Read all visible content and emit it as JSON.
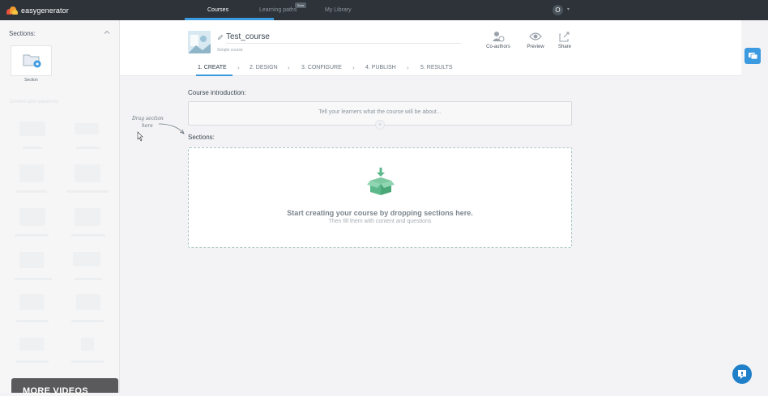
{
  "app": {
    "logo_text": "easygenerator",
    "nav": [
      {
        "label": "Courses",
        "active": true
      },
      {
        "label": "Learning paths",
        "badge": "Beta"
      },
      {
        "label": "My Library"
      }
    ],
    "user_initial": "O"
  },
  "sidebar": {
    "title": "Sections:",
    "section_card_label": "Section",
    "faded_title": "Content and questions"
  },
  "course": {
    "title": "Test_course",
    "subtitle": "Simple course",
    "actions": [
      {
        "label": "Co-authors",
        "icon": "co-authors-icon"
      },
      {
        "label": "Preview",
        "icon": "eye-icon"
      },
      {
        "label": "Share",
        "icon": "share-icon"
      }
    ],
    "steps": [
      {
        "label": "1. CREATE",
        "active": true
      },
      {
        "label": "2. DESIGN"
      },
      {
        "label": "3. CONFIGURE"
      },
      {
        "label": "4. PUBLISH"
      },
      {
        "label": "5. RESULTS"
      }
    ]
  },
  "content": {
    "intro_label": "Course introduction:",
    "intro_placeholder": "Tell your learners what the course will be about...",
    "sections_label": "Sections:",
    "drop_main": "Start creating your course by dropping sections here.",
    "drop_sub": "Then fill them with content and questions",
    "hint_line1": "Drag section",
    "hint_line2": "here"
  },
  "footer": {
    "more_videos": "MORE VIDEOS"
  },
  "colors": {
    "topbar": "#2d3339",
    "accent": "#3c9ae0",
    "green": "#5cb88a"
  }
}
